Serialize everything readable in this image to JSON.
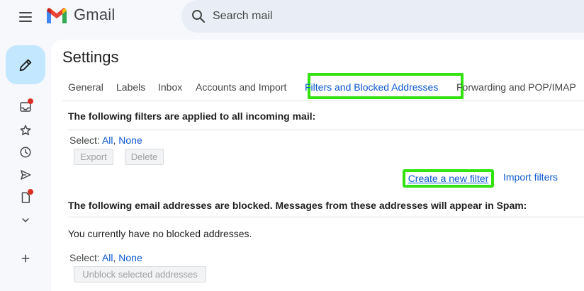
{
  "app": {
    "name": "Gmail",
    "colors": {
      "accent": "#0b57d0",
      "compose_bg": "#c2e7ff",
      "highlight": "#33e30f",
      "notification": "#d93025"
    }
  },
  "search": {
    "placeholder": "Search mail"
  },
  "rail": {
    "icons": [
      "compose-pencil-icon",
      "inbox-icon",
      "star-icon",
      "clock-icon",
      "send-icon",
      "draft-icon",
      "chevron-down-icon",
      "plus-icon"
    ]
  },
  "settings": {
    "title": "Settings",
    "tabs": [
      {
        "label": "General"
      },
      {
        "label": "Labels"
      },
      {
        "label": "Inbox"
      },
      {
        "label": "Accounts and Import"
      },
      {
        "label": "Filters and Blocked Addresses",
        "active": true
      },
      {
        "label": "Forwarding and POP/IMAP"
      }
    ],
    "filters": {
      "heading": "The following filters are applied to all incoming mail:",
      "select_label": "Select:",
      "select_all": "All",
      "select_sep": ",",
      "select_none": "None",
      "export_label": "Export",
      "delete_label": "Delete",
      "create_filter_label": "Create a new filter",
      "import_filters_label": "Import filters"
    },
    "blocked": {
      "heading": "The following email addresses are blocked. Messages from these addresses will appear in Spam:",
      "empty_text": "You currently have no blocked addresses.",
      "select_label": "Select:",
      "select_all": "All",
      "select_sep": ",",
      "select_none": "None",
      "unblock_label": "Unblock selected addresses"
    }
  }
}
